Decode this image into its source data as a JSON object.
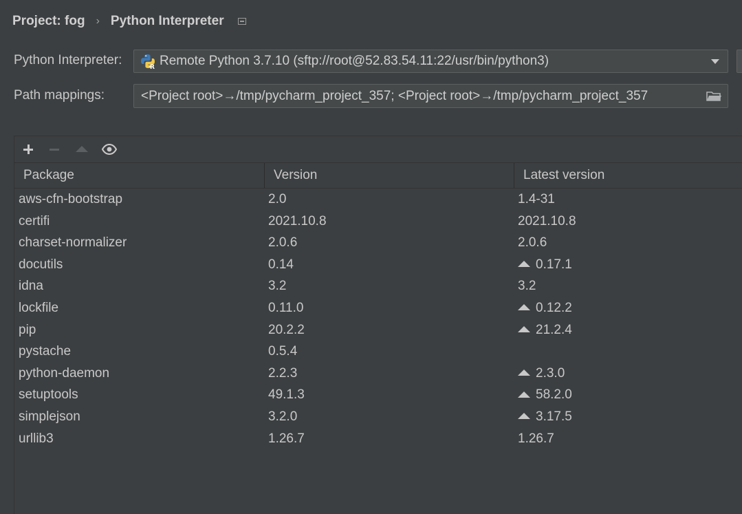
{
  "breadcrumb": {
    "project": "Project: fog",
    "separator": "›",
    "current": "Python Interpreter",
    "pin_icon": "pin-window-icon"
  },
  "interpreter": {
    "label": "Python Interpreter:",
    "value": "Remote Python 3.7.10 (sftp://root@52.83.54.11:22/usr/bin/python3)",
    "icon": "python-remote-icon"
  },
  "path_mappings": {
    "label": "Path mappings:",
    "value": "<Project root>→/tmp/pycharm_project_357; <Project root>→/tmp/pycharm_project_357",
    "icon": "folder-icon"
  },
  "toolbar": {
    "add_icon": "plus-icon",
    "remove_icon": "minus-icon",
    "upgrade_icon": "upgrade-icon",
    "show_early_releases_icon": "eye-icon"
  },
  "table": {
    "columns": [
      "Package",
      "Version",
      "Latest version"
    ],
    "rows": [
      {
        "package": "aws-cfn-bootstrap",
        "version": "2.0",
        "latest": "1.4-31",
        "upgrade": false
      },
      {
        "package": "certifi",
        "version": "2021.10.8",
        "latest": "2021.10.8",
        "upgrade": false
      },
      {
        "package": "charset-normalizer",
        "version": "2.0.6",
        "latest": "2.0.6",
        "upgrade": false
      },
      {
        "package": "docutils",
        "version": "0.14",
        "latest": "0.17.1",
        "upgrade": true
      },
      {
        "package": "idna",
        "version": "3.2",
        "latest": "3.2",
        "upgrade": false
      },
      {
        "package": "lockfile",
        "version": "0.11.0",
        "latest": "0.12.2",
        "upgrade": true
      },
      {
        "package": "pip",
        "version": "20.2.2",
        "latest": "21.2.4",
        "upgrade": true
      },
      {
        "package": "pystache",
        "version": "0.5.4",
        "latest": "",
        "upgrade": false
      },
      {
        "package": "python-daemon",
        "version": "2.2.3",
        "latest": "2.3.0",
        "upgrade": true
      },
      {
        "package": "setuptools",
        "version": "49.1.3",
        "latest": "58.2.0",
        "upgrade": true
      },
      {
        "package": "simplejson",
        "version": "3.2.0",
        "latest": "3.17.5",
        "upgrade": true
      },
      {
        "package": "urllib3",
        "version": "1.26.7",
        "latest": "1.26.7",
        "upgrade": false
      }
    ]
  },
  "colors": {
    "background": "#3c3f41",
    "field": "#45494a",
    "text": "#c8c8c8",
    "link": "#589df6"
  }
}
